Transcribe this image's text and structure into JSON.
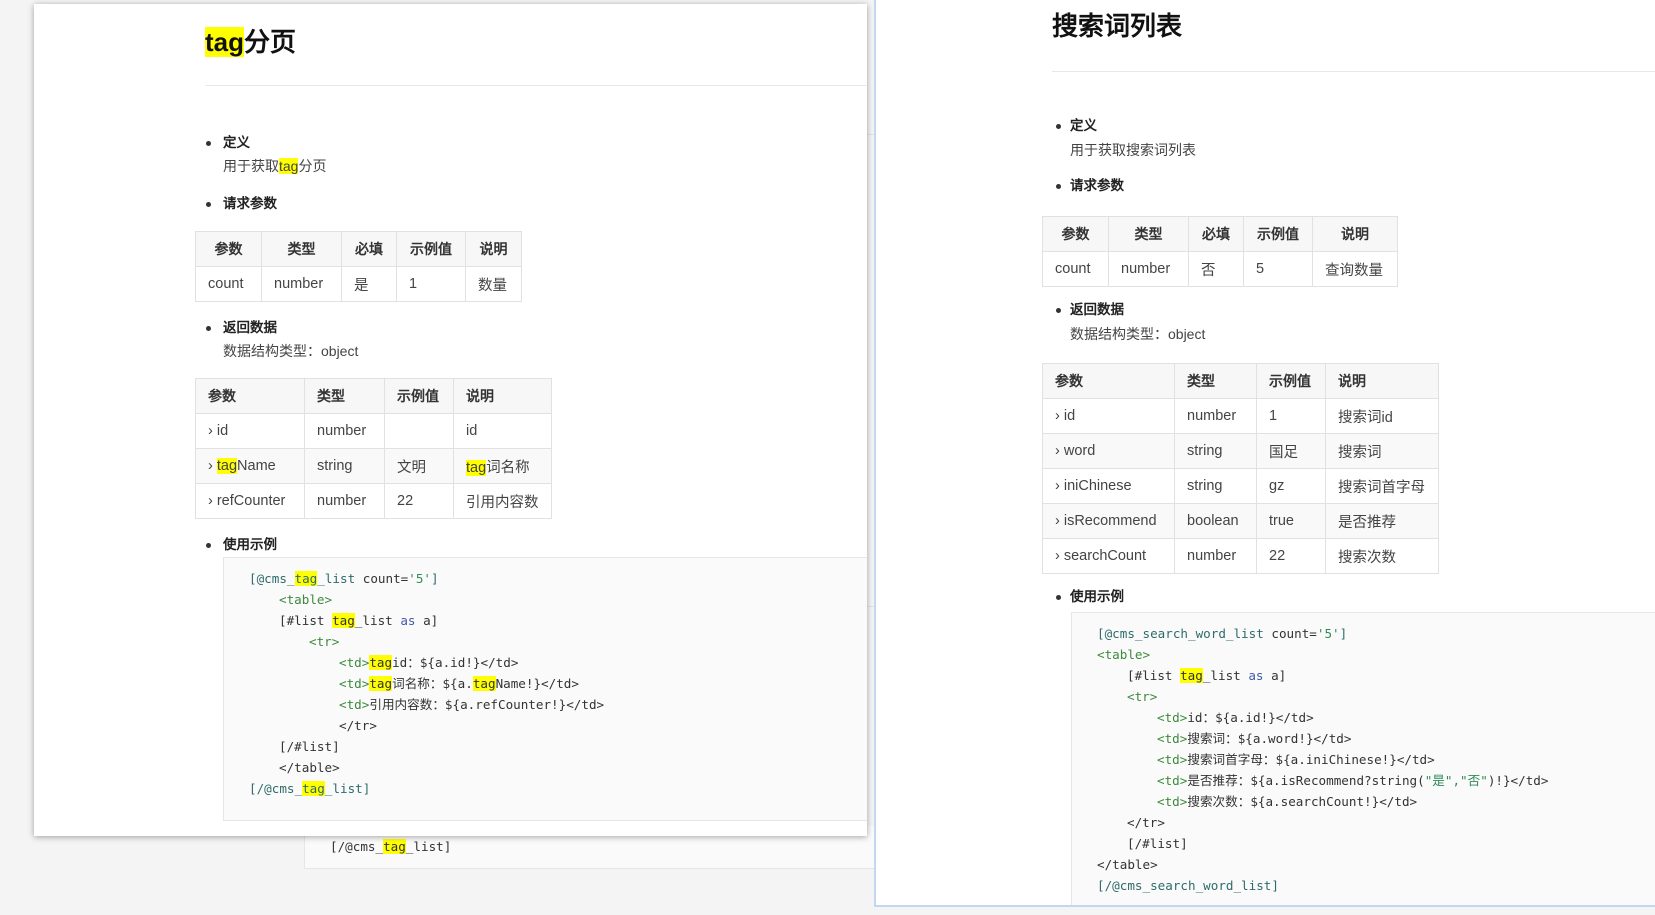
{
  "highlight_term": "tag",
  "colors": {
    "highlight": "#ffff00",
    "window_border_accent": "#c3d8f0"
  },
  "backdrop": {
    "code_tail": "[/@cms_tag_list]"
  },
  "left_doc": {
    "title": "tag分页",
    "definition_label": "定义",
    "definition_text": "用于获取tag分页",
    "request_label": "请求参数",
    "request_table": {
      "headers": [
        "参数",
        "类型",
        "必填",
        "示例值",
        "说明"
      ],
      "rows": [
        [
          "count",
          "number",
          "是",
          "1",
          "数量"
        ]
      ]
    },
    "response_label": "返回数据",
    "response_type_text": "数据结构类型：object",
    "response_table": {
      "headers": [
        "参数",
        "类型",
        "示例值",
        "说明"
      ],
      "rows": [
        [
          "› id",
          "number",
          "",
          "id"
        ],
        [
          "› tagName",
          "string",
          "文明",
          "tag词名称"
        ],
        [
          "› refCounter",
          "number",
          "22",
          "引用内容数"
        ]
      ]
    },
    "example_label": "使用示例",
    "code": [
      {
        "indent": 0,
        "seg": [
          [
            "[@cms_tag_list",
            "macro"
          ],
          [
            " count=",
            "plain"
          ],
          [
            "'5'",
            "string"
          ],
          [
            "]",
            "macro"
          ]
        ]
      },
      {
        "indent": 1,
        "seg": [
          [
            "<table>",
            "tag"
          ]
        ]
      },
      {
        "indent": 1,
        "seg": [
          [
            "[#list tag_list ",
            "plain"
          ],
          [
            "as",
            "keyword"
          ],
          [
            " a]",
            "plain"
          ]
        ]
      },
      {
        "indent": 2,
        "seg": [
          [
            "<tr>",
            "tag"
          ]
        ]
      },
      {
        "indent": 3,
        "seg": [
          [
            "<td>",
            "tag"
          ],
          [
            "tagid：${a.id!}</td>",
            "plain"
          ]
        ]
      },
      {
        "indent": 3,
        "seg": [
          [
            "<td>",
            "tag"
          ],
          [
            "tag词名称：${a.tagName!}</td>",
            "plain"
          ]
        ]
      },
      {
        "indent": 3,
        "seg": [
          [
            "<td>",
            "tag"
          ],
          [
            "引用内容数：${a.refCounter!}</td>",
            "plain"
          ]
        ]
      },
      {
        "indent": 3,
        "seg": [
          [
            "</tr>",
            "plain"
          ]
        ]
      },
      {
        "indent": 1,
        "seg": [
          [
            "[/#list]",
            "plain"
          ]
        ]
      },
      {
        "indent": 1,
        "seg": [
          [
            "</table>",
            "plain"
          ]
        ]
      },
      {
        "indent": 0,
        "seg": [
          [
            "[/@cms_tag_list]",
            "macro"
          ]
        ]
      }
    ]
  },
  "right_doc": {
    "title": "搜索词列表",
    "definition_label": "定义",
    "definition_text": "用于获取搜索词列表",
    "request_label": "请求参数",
    "request_table": {
      "headers": [
        "参数",
        "类型",
        "必填",
        "示例值",
        "说明"
      ],
      "rows": [
        [
          "count",
          "number",
          "否",
          "5",
          "查询数量"
        ]
      ]
    },
    "response_label": "返回数据",
    "response_type_text": "数据结构类型：object",
    "response_table": {
      "headers": [
        "参数",
        "类型",
        "示例值",
        "说明"
      ],
      "rows": [
        [
          "› id",
          "number",
          "1",
          "搜索词id"
        ],
        [
          "› word",
          "string",
          "国足",
          "搜索词"
        ],
        [
          "› iniChinese",
          "string",
          "gz",
          "搜索词首字母"
        ],
        [
          "› isRecommend",
          "boolean",
          "true",
          "是否推荐"
        ],
        [
          "› searchCount",
          "number",
          "22",
          "搜索次数"
        ]
      ]
    },
    "example_label": "使用示例",
    "code": [
      {
        "indent": 0,
        "seg": [
          [
            "[@cms_search_word_list",
            "macro"
          ],
          [
            " count=",
            "plain"
          ],
          [
            "'5'",
            "string"
          ],
          [
            "]",
            "macro"
          ]
        ]
      },
      {
        "indent": 0,
        "seg": [
          [
            "<table>",
            "tag"
          ]
        ]
      },
      {
        "indent": 1,
        "seg": [
          [
            "[#list tag_list ",
            "plain"
          ],
          [
            "as",
            "keyword"
          ],
          [
            " a]",
            "plain"
          ]
        ]
      },
      {
        "indent": 1,
        "seg": [
          [
            "<tr>",
            "tag"
          ]
        ]
      },
      {
        "indent": 2,
        "seg": [
          [
            "<td>",
            "tag"
          ],
          [
            "id：${a.id!}</td>",
            "plain"
          ]
        ]
      },
      {
        "indent": 2,
        "seg": [
          [
            "<td>",
            "tag"
          ],
          [
            "搜索词：${a.word!}</td>",
            "plain"
          ]
        ]
      },
      {
        "indent": 2,
        "seg": [
          [
            "<td>",
            "tag"
          ],
          [
            "搜索词首字母：${a.iniChinese!}</td>",
            "plain"
          ]
        ]
      },
      {
        "indent": 2,
        "seg": [
          [
            "<td>",
            "tag"
          ],
          [
            "是否推荐：${a.isRecommend?string(",
            "plain"
          ],
          [
            "\"是\",\"否\"",
            "string"
          ],
          [
            ")!}</td>",
            "plain"
          ]
        ]
      },
      {
        "indent": 2,
        "seg": [
          [
            "<td>",
            "tag"
          ],
          [
            "搜索次数：${a.searchCount!}</td>",
            "plain"
          ]
        ]
      },
      {
        "indent": 1,
        "seg": [
          [
            "</tr>",
            "plain"
          ]
        ]
      },
      {
        "indent": 1,
        "seg": [
          [
            "[/#list]",
            "plain"
          ]
        ]
      },
      {
        "indent": 0,
        "seg": [
          [
            "</table>",
            "plain"
          ]
        ]
      },
      {
        "indent": 0,
        "seg": [
          [
            "[/@cms_search_word_list]",
            "macro"
          ]
        ]
      }
    ]
  }
}
